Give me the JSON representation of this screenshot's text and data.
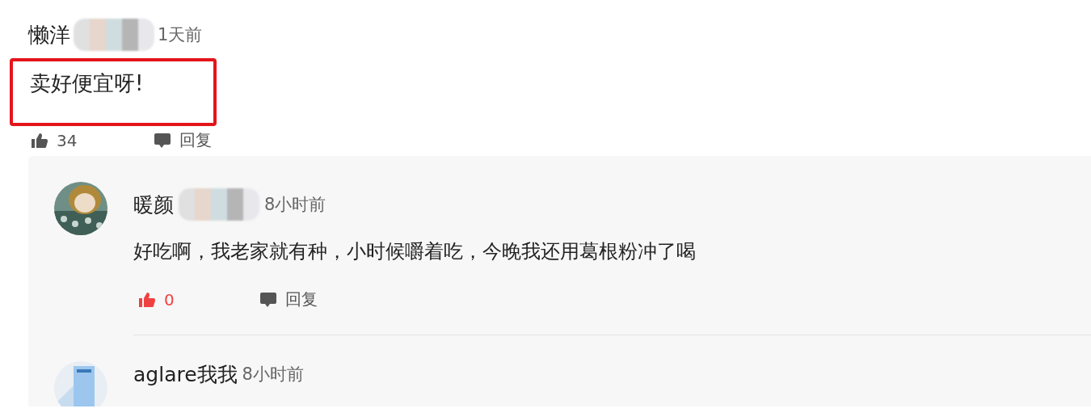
{
  "comment": {
    "author": "懒洋",
    "time": "1天前",
    "text": "卖好便宜呀!",
    "highlighted": true,
    "likes": "34",
    "liked": false,
    "reply_label": "回复"
  },
  "replies": [
    {
      "author": "暖颜",
      "time": "8小时前",
      "text": "好吃啊，我老家就有种，小时候嚼着吃，今晚我还用葛根粉冲了喝",
      "likes": "0",
      "liked": true,
      "reply_label": "回复"
    },
    {
      "author": "aglare我我",
      "time": "8小时前"
    }
  ]
}
